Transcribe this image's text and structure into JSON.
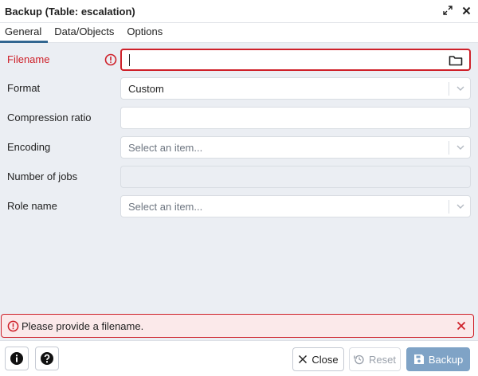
{
  "window": {
    "title": "Backup (Table: escalation)"
  },
  "tabs": [
    {
      "label": "General",
      "active": true
    },
    {
      "label": "Data/Objects",
      "active": false
    },
    {
      "label": "Options",
      "active": false
    }
  ],
  "form": {
    "filename": {
      "label": "Filename",
      "value": ""
    },
    "format": {
      "label": "Format",
      "value": "Custom"
    },
    "compression": {
      "label": "Compression ratio",
      "value": ""
    },
    "encoding": {
      "label": "Encoding",
      "placeholder": "Select an item..."
    },
    "jobs": {
      "label": "Number of jobs",
      "value": ""
    },
    "role": {
      "label": "Role name",
      "placeholder": "Select an item..."
    }
  },
  "alert": {
    "message": "Please provide a filename."
  },
  "footer": {
    "close_label": "Close",
    "reset_label": "Reset",
    "backup_label": "Backup"
  },
  "colors": {
    "error": "#ce2029",
    "accent": "#326690",
    "primary_disabled": "#7fa3c6",
    "panel": "#ebeef3"
  },
  "icons": [
    "expand-icon",
    "close-icon",
    "folder-icon",
    "error-icon",
    "chevron-down-icon",
    "info-icon",
    "help-icon",
    "reset-icon",
    "save-icon"
  ]
}
